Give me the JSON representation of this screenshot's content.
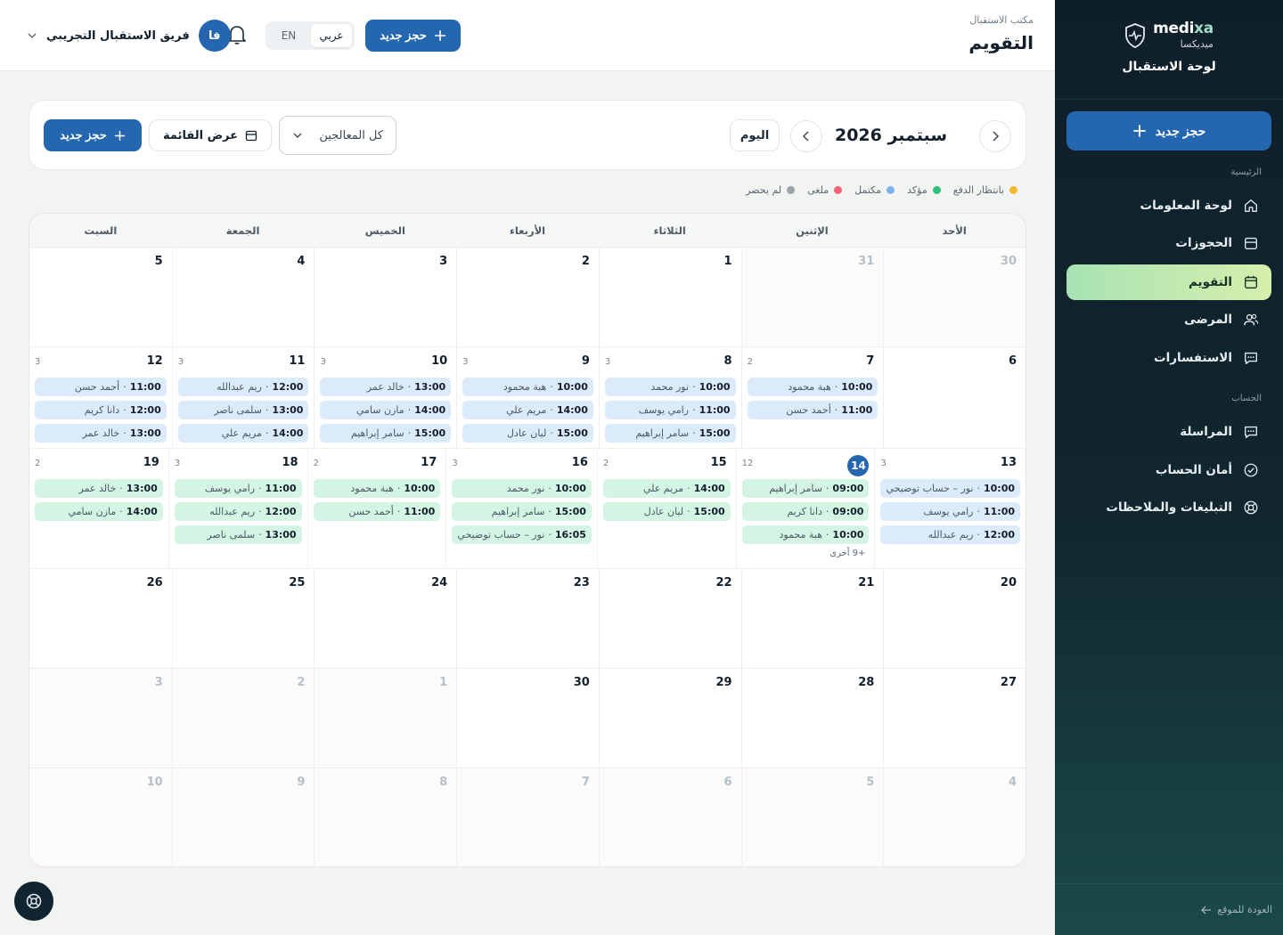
{
  "brand": {
    "name_en_main": "medi",
    "name_en_accent": "xa",
    "name_ar": "ميديكسا",
    "title": "لوحة الاستقبال"
  },
  "sidebar": {
    "new_booking": "حجز جديد",
    "section_main": "الرئيسية",
    "section_account": "الحساب",
    "items": [
      {
        "label": "لوحة المعلومات",
        "icon": "home-icon"
      },
      {
        "label": "الحجوزات",
        "icon": "clipboard-icon"
      },
      {
        "label": "التقويم",
        "icon": "calendar-icon"
      },
      {
        "label": "المرضى",
        "icon": "users-icon"
      },
      {
        "label": "الاستفسارات",
        "icon": "chat-icon"
      }
    ],
    "account_items": [
      {
        "label": "المراسلة",
        "icon": "message-icon"
      },
      {
        "label": "أمان الحساب",
        "icon": "check-circle-icon"
      },
      {
        "label": "التبليغات والملاحظات",
        "icon": "lifebuoy-icon"
      }
    ],
    "back_link": "العودة للموقع"
  },
  "topbar": {
    "crumb": "مكتب الاستقبال",
    "title": "التقويم",
    "new_booking": "حجز جديد",
    "lang_ar": "عربي",
    "lang_en": "EN",
    "user_initials": "فا",
    "user_name": "فريق الاستقبال التجريبي"
  },
  "toolbar": {
    "month_label": "سبتمبر 2026",
    "today": "اليوم",
    "filter_value": "كل المعالجين",
    "list_view": "عرض القائمة",
    "new_booking": "حجز جديد"
  },
  "legend": [
    {
      "label": "بانتظار الدفع",
      "color": "#f5b82e"
    },
    {
      "label": "مؤكد",
      "color": "#2fbf7a"
    },
    {
      "label": "مكتمل",
      "color": "#7fb1ea"
    },
    {
      "label": "ملغى",
      "color": "#f2647a"
    },
    {
      "label": "لم يحضر",
      "color": "#9aa4ab"
    }
  ],
  "weekdays": [
    "الأحد",
    "الإثنين",
    "الثلاثاء",
    "الأربعاء",
    "الخميس",
    "الجمعة",
    "السبت"
  ],
  "weeks": [
    {
      "height": 112,
      "days": [
        {
          "num": "30",
          "other": true
        },
        {
          "num": "31",
          "other": true
        },
        {
          "num": "1"
        },
        {
          "num": "2"
        },
        {
          "num": "3"
        },
        {
          "num": "4"
        },
        {
          "num": "5"
        }
      ]
    },
    {
      "height": 114,
      "days": [
        {
          "num": "6"
        },
        {
          "num": "7",
          "count": "2",
          "events": [
            {
              "time": "10:00",
              "name": "هبة محمود",
              "kind": "blue"
            },
            {
              "time": "11:00",
              "name": "أحمد حسن",
              "kind": "blue"
            }
          ]
        },
        {
          "num": "8",
          "count": "3",
          "events": [
            {
              "time": "10:00",
              "name": "نور محمد",
              "kind": "blue"
            },
            {
              "time": "11:00",
              "name": "رامي يوسف",
              "kind": "blue"
            },
            {
              "time": "15:00",
              "name": "سامر إبراهيم",
              "kind": "blue"
            }
          ]
        },
        {
          "num": "9",
          "count": "3",
          "events": [
            {
              "time": "10:00",
              "name": "هبة محمود",
              "kind": "blue"
            },
            {
              "time": "14:00",
              "name": "مريم علي",
              "kind": "blue"
            },
            {
              "time": "15:00",
              "name": "ليان عادل",
              "kind": "blue"
            }
          ]
        },
        {
          "num": "10",
          "count": "3",
          "events": [
            {
              "time": "13:00",
              "name": "خالد عمر",
              "kind": "blue"
            },
            {
              "time": "14:00",
              "name": "مازن سامي",
              "kind": "blue"
            },
            {
              "time": "15:00",
              "name": "سامر إبراهيم",
              "kind": "blue"
            }
          ]
        },
        {
          "num": "11",
          "count": "3",
          "events": [
            {
              "time": "12:00",
              "name": "ريم عبدالله",
              "kind": "blue"
            },
            {
              "time": "13:00",
              "name": "سلمى ناصر",
              "kind": "blue"
            },
            {
              "time": "14:00",
              "name": "مريم علي",
              "kind": "blue"
            }
          ]
        },
        {
          "num": "12",
          "count": "3",
          "events": [
            {
              "time": "11:00",
              "name": "أحمد حسن",
              "kind": "blue"
            },
            {
              "time": "12:00",
              "name": "دانا كريم",
              "kind": "blue"
            },
            {
              "time": "13:00",
              "name": "خالد عمر",
              "kind": "blue"
            }
          ]
        }
      ]
    },
    {
      "height": 135,
      "days": [
        {
          "num": "13",
          "count": "3",
          "events": [
            {
              "time": "10:00",
              "name": "نور – حساب توضيحي",
              "kind": "blue"
            },
            {
              "time": "11:00",
              "name": "رامي يوسف",
              "kind": "blue"
            },
            {
              "time": "12:00",
              "name": "ريم عبدالله",
              "kind": "blue"
            }
          ]
        },
        {
          "num": "14",
          "today": true,
          "count": "12",
          "events": [
            {
              "time": "09:00",
              "name": "سامر إبراهيم",
              "kind": "green"
            },
            {
              "time": "09:00",
              "name": "دانا كريم",
              "kind": "green"
            },
            {
              "time": "10:00",
              "name": "هبة محمود",
              "kind": "green"
            }
          ],
          "more": "+9 أخرى"
        },
        {
          "num": "15",
          "count": "2",
          "events": [
            {
              "time": "14:00",
              "name": "مريم علي",
              "kind": "green"
            },
            {
              "time": "15:00",
              "name": "ليان عادل",
              "kind": "green"
            }
          ]
        },
        {
          "num": "16",
          "count": "3",
          "events": [
            {
              "time": "10:00",
              "name": "نور محمد",
              "kind": "green"
            },
            {
              "time": "15:00",
              "name": "سامر إبراهيم",
              "kind": "green"
            },
            {
              "time": "16:05",
              "name": "نور – حساب توضيحي",
              "kind": "green"
            }
          ]
        },
        {
          "num": "17",
          "count": "2",
          "events": [
            {
              "time": "10:00",
              "name": "هبة محمود",
              "kind": "green"
            },
            {
              "time": "11:00",
              "name": "أحمد حسن",
              "kind": "green"
            }
          ]
        },
        {
          "num": "18",
          "count": "3",
          "events": [
            {
              "time": "11:00",
              "name": "رامي يوسف",
              "kind": "green"
            },
            {
              "time": "12:00",
              "name": "ريم عبدالله",
              "kind": "green"
            },
            {
              "time": "13:00",
              "name": "سلمى ناصر",
              "kind": "green"
            }
          ]
        },
        {
          "num": "19",
          "count": "2",
          "events": [
            {
              "time": "13:00",
              "name": "خالد عمر",
              "kind": "green"
            },
            {
              "time": "14:00",
              "name": "مازن سامي",
              "kind": "green"
            }
          ]
        }
      ]
    },
    {
      "height": 112,
      "days": [
        {
          "num": "20"
        },
        {
          "num": "21"
        },
        {
          "num": "22"
        },
        {
          "num": "23"
        },
        {
          "num": "24"
        },
        {
          "num": "25"
        },
        {
          "num": "26"
        }
      ]
    },
    {
      "height": 112,
      "days": [
        {
          "num": "27"
        },
        {
          "num": "28"
        },
        {
          "num": "29"
        },
        {
          "num": "30"
        },
        {
          "num": "1",
          "other": true
        },
        {
          "num": "2",
          "other": true
        },
        {
          "num": "3",
          "other": true
        }
      ]
    },
    {
      "height": 112,
      "days": [
        {
          "num": "4",
          "other": true
        },
        {
          "num": "5",
          "other": true
        },
        {
          "num": "6",
          "other": true
        },
        {
          "num": "7",
          "other": true
        },
        {
          "num": "8",
          "other": true
        },
        {
          "num": "9",
          "other": true
        },
        {
          "num": "10",
          "other": true
        }
      ]
    }
  ],
  "colors": {
    "primary": "#2466b0",
    "sidebar_bg": "#0f1f2a",
    "active_nav": "#c8eab0",
    "event_blue": "#dcebfb",
    "event_green": "#d4f5e4"
  }
}
